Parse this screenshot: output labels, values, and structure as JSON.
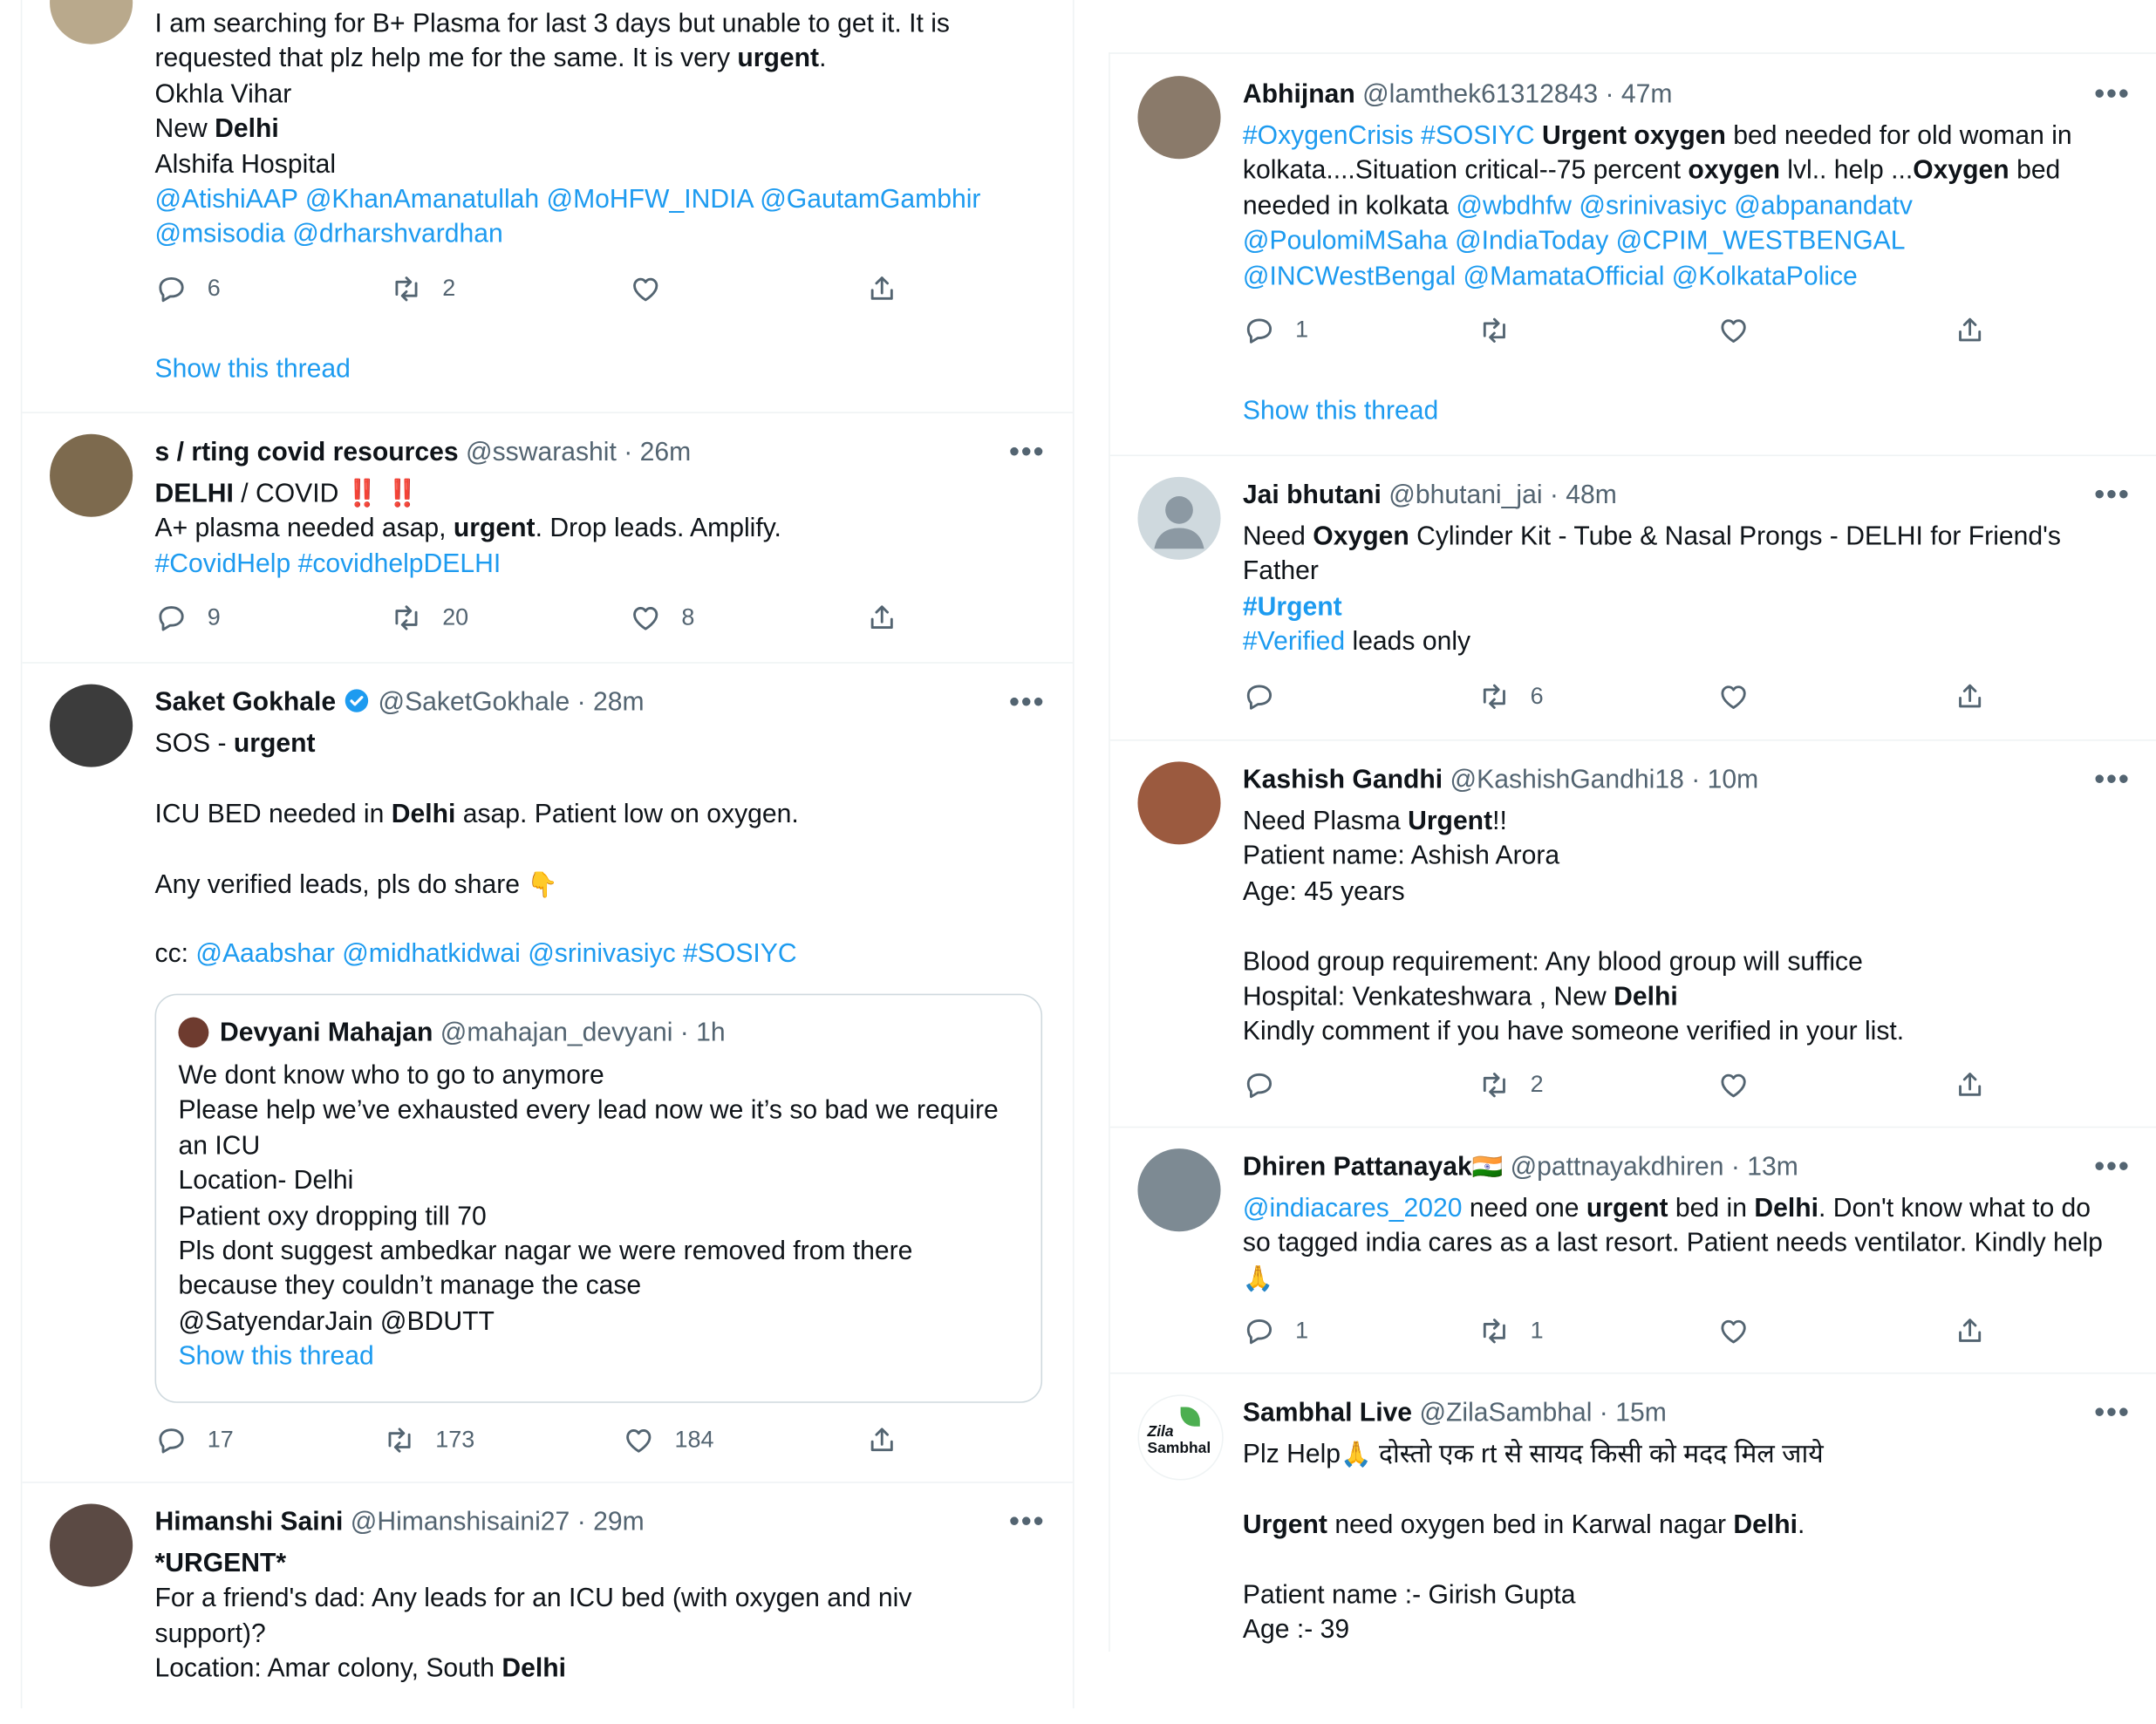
{
  "left_column": {
    "tweet1": {
      "lines": [
        "I am searching for B+ Plasma for last 3 days but unable to get it. It is",
        "requested that plz help me for the same. It is very",
        "urgent",
        ".",
        "Okhla Vihar",
        "New ",
        "Delhi",
        "Alshifa Hospital",
        "@AtishiAAP @KhanAmanatullah @MoHFW_INDIA @GautamGambhir",
        "@msisodia @drharshvardhan"
      ],
      "replies": "6",
      "retweets": "2",
      "likes": "",
      "show_thread": "Show this thread"
    },
    "tweet2": {
      "name": "s / rting covid resources",
      "handle": "@sswarashit",
      "time": "· 26m",
      "l1_b": "DELHI",
      "l1_rest": " / COVID ",
      "l1_emoji": "‼️ ‼️",
      "l2_a": "A+ plasma needed asap, ",
      "l2_b": "urgent",
      "l2_c": ". Drop leads. Amplify.",
      "l3_tags": "#CovidHelp  #covidhelpDELHI",
      "replies": "9",
      "retweets": "20",
      "likes": "8"
    },
    "tweet3": {
      "name": "Saket Gokhale",
      "handle": "@SaketGokhale",
      "time": "· 28m",
      "l1_a": "SOS - ",
      "l1_b": "urgent",
      "l2_a": "ICU BED needed in ",
      "l2_b": "Delhi",
      "l2_c": " asap. Patient low on oxygen.",
      "l3": "Any verified leads, pls do share ",
      "l3_emoji": "👇",
      "l4_a": "cc: ",
      "l4_links": "@Aaabshar @midhatkidwai @srinivasiyc #SOSIYC",
      "quote": {
        "name": "Devyani Mahajan",
        "handle": "@mahajan_devyani",
        "time": "· 1h",
        "lines": [
          "We dont know who to go to anymore",
          "Please help we’ve exhausted every lead now we it’s so bad we require",
          "an ICU",
          "Location- Delhi",
          "Patient oxy dropping till 70",
          "Pls dont suggest ambedkar nagar we were removed from there",
          "because they couldn’t manage the case",
          "@SatyendarJain @BDUTT"
        ],
        "show_thread": "Show this thread"
      },
      "replies": "17",
      "retweets": "173",
      "likes": "184"
    },
    "tweet4": {
      "name": "Himanshi Saini",
      "handle": "@Himanshisaini27",
      "time": "· 29m",
      "l1": "*URGENT*",
      "l2": "For a friend's dad: Any leads for an ICU bed (with oxygen and niv",
      "l3": "support)?",
      "l4_a": "Location: Amar colony, South ",
      "l4_b": "Delhi"
    }
  },
  "right_column": {
    "tweet1": {
      "name": "Abhijnan",
      "handle": "@lamthek61312843",
      "time": "· 47m",
      "l1_tags": "#OxygenCrisis #SOSIYC ",
      "l1_b": "Urgent oxygen",
      "l1_c": " bed needed for old woman in",
      "l2_a": "kolkata....Situation critical--75 percent ",
      "l2_b": "oxygen",
      "l2_c": " lvl.. help ...",
      "l2_d": "Oxygen",
      "l2_e": " bed",
      "l3_a": "needed in kolkata ",
      "l3_links": "@wbdhfw @srinivasiyc @abpanandatv",
      "l4": "@PoulomiMSaha @IndiaToday @CPIM_WESTBENGAL",
      "l5": "@INCWestBengal @MamataOfficial @KolkataPolice",
      "replies": "1",
      "retweets": "",
      "likes": "",
      "show_thread": "Show this thread"
    },
    "tweet2": {
      "name": "Jai bhutani",
      "handle": "@bhutani_jai",
      "time": "· 48m",
      "l1_a": "Need ",
      "l1_b": "Oxygen",
      "l1_c": " Cylinder Kit - Tube & Nasal Prongs - DELHI for Friend's",
      "l2": "Father",
      "l3": "#Urgent",
      "l4_tag": "#Verified",
      "l4_rest": " leads only",
      "replies": "",
      "retweets": "6",
      "likes": ""
    },
    "tweet3": {
      "name": "Kashish Gandhi",
      "handle": "@KashishGandhi18",
      "time": "· 10m",
      "l1_a": "Need Plasma ",
      "l1_b": "Urgent",
      "l1_c": "!!",
      "l2": "Patient name: Ashish Arora",
      "l3": "Age: 45 years",
      "l4": "Blood group requirement: Any blood group will suffice",
      "l5_a": "Hospital: Venkateshwara , New ",
      "l5_b": "Delhi",
      "l6": "Kindly comment if you have someone verified in your list.",
      "replies": "",
      "retweets": "2",
      "likes": ""
    },
    "tweet4": {
      "name": "Dhiren Pattanayak",
      "flag": "🇮🇳",
      "handle": "@pattnayakdhiren",
      "time": "· 13m",
      "l1_link": "@indiacares_2020",
      "l1_a": " need one ",
      "l1_b": "urgent",
      "l1_c": " bed in ",
      "l1_d": "Delhi",
      "l1_e": ". Don't know what to do",
      "l2": "so tagged india cares as a last resort. Patient needs ventilator. Kindly help",
      "l3_emoji": "🙏",
      "replies": "1",
      "retweets": "1",
      "likes": ""
    },
    "tweet5": {
      "name": "Sambhal Live",
      "handle": "@ZilaSambhal",
      "time": "· 15m",
      "avatar_text_1": "Zila",
      "avatar_text_2": "Sambhal",
      "l1_a": "Plz Help",
      "l1_emoji": "🙏",
      "l1_b": " दोस्तो एक rt से सायद किसी को मदद मिल जाये",
      "l2_b": "Urgent",
      "l2_a": " need oxygen bed in Karwal nagar ",
      "l2_c": "Delhi",
      "l2_d": ".",
      "l3": "Patient name :- Girish Gupta",
      "l4": "Age :- 39"
    }
  },
  "icons": [
    "reply-icon",
    "retweet-icon",
    "like-icon",
    "share-icon",
    "more-icon",
    "verified-icon"
  ],
  "colors": {
    "link": "#1d9bf0",
    "muted": "#536471",
    "text": "#0f1419",
    "border": "#eff3f4"
  }
}
